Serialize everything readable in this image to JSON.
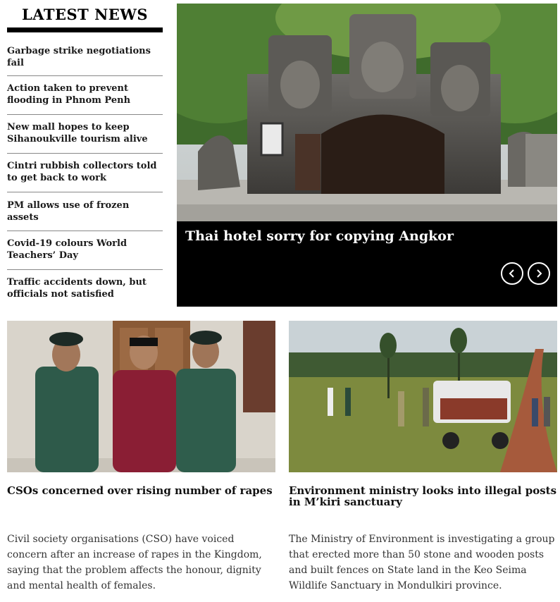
{
  "latest_news": {
    "title": "LATEST NEWS",
    "items": [
      "Garbage strike negotiations fail",
      "Action taken to prevent flooding in Phnom Penh",
      "New mall hopes to keep Sihanoukville tourism alive",
      "Cintri rubbish collectors told to get back to work",
      "PM allows use of frozen assets",
      "Covid-19 colours World Teachers’ Day",
      "Traffic accidents down, but officials not satisfied"
    ]
  },
  "slider": {
    "caption": "Thai hotel sorry for copying Angkor",
    "prev_icon": "chevron-left-icon",
    "next_icon": "chevron-right-icon"
  },
  "stories": [
    {
      "title": "CSOs concerned over rising number of rapes",
      "description": "Civil society organisations (CSO) have voiced concern after an increase of rapes in the Kingdom, saying that the problem affects the honour, dignity and mental health of females."
    },
    {
      "title": "Environment ministry looks into illegal posts in M’kiri sanctuary",
      "description": "The Ministry of Environment is investigating a group that erected more than 50 stone and wooden posts and built fences on State land in the Keo Seima Wildlife Sanctuary in Mondulkiri province."
    }
  ]
}
